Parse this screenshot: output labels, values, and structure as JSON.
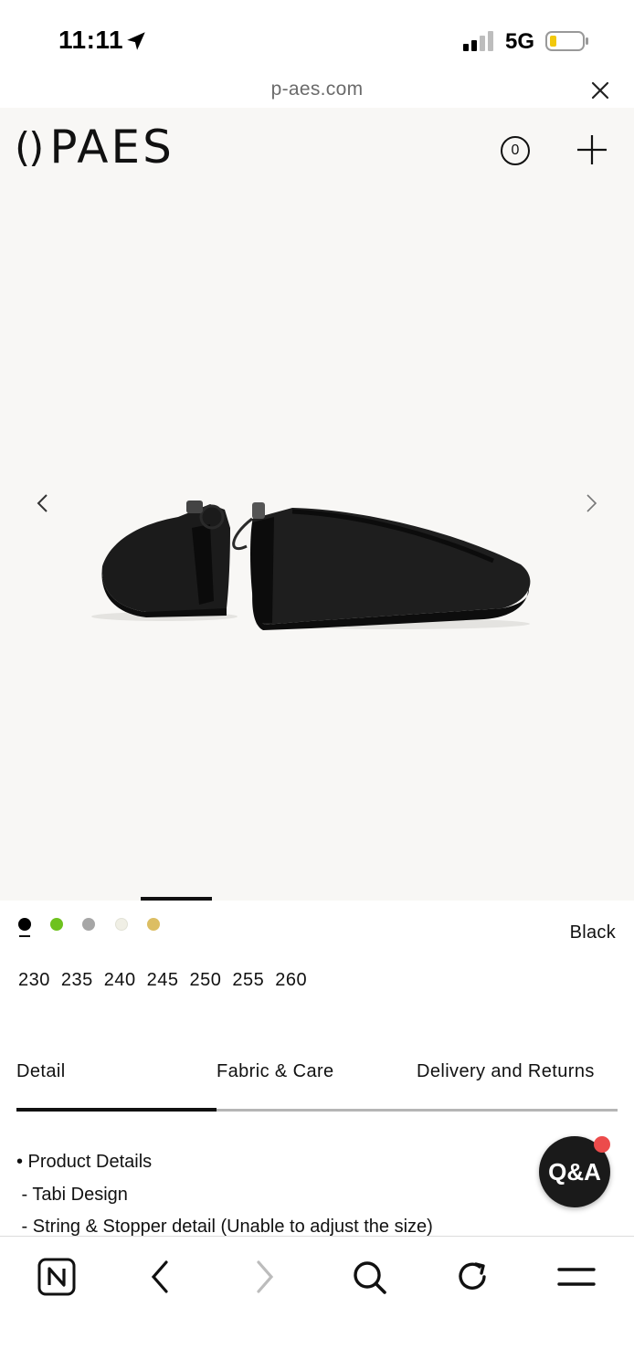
{
  "status": {
    "time": "11:11",
    "network": "5G"
  },
  "browser": {
    "url": "p-aes.com"
  },
  "header": {
    "logo_mark": "()",
    "brand": "PAES",
    "cart_count": "0"
  },
  "product": {
    "colors": [
      {
        "name": "black",
        "hex": "#000000"
      },
      {
        "name": "green",
        "hex": "#6ec21e"
      },
      {
        "name": "gray",
        "hex": "#a6a6a6"
      },
      {
        "name": "cream",
        "hex": "#f0efe5"
      },
      {
        "name": "gold",
        "hex": "#dcbe63"
      }
    ],
    "selected_color": "Black",
    "sizes": [
      "230",
      "235",
      "240",
      "245",
      "250",
      "255",
      "260"
    ]
  },
  "tabs": [
    {
      "label": "Detail"
    },
    {
      "label": "Fabric & Care"
    },
    {
      "label": "Delivery and Returns"
    }
  ],
  "details": {
    "lines": [
      "• Product Details",
      " - Tabi Design",
      " - String & Stopper detail (Unable to adjust the size)"
    ]
  },
  "qa": {
    "label": "Q&A"
  },
  "bottom_nav": [
    "naver-icon",
    "back-icon",
    "forward-icon",
    "search-icon",
    "refresh-icon",
    "menu-icon"
  ]
}
